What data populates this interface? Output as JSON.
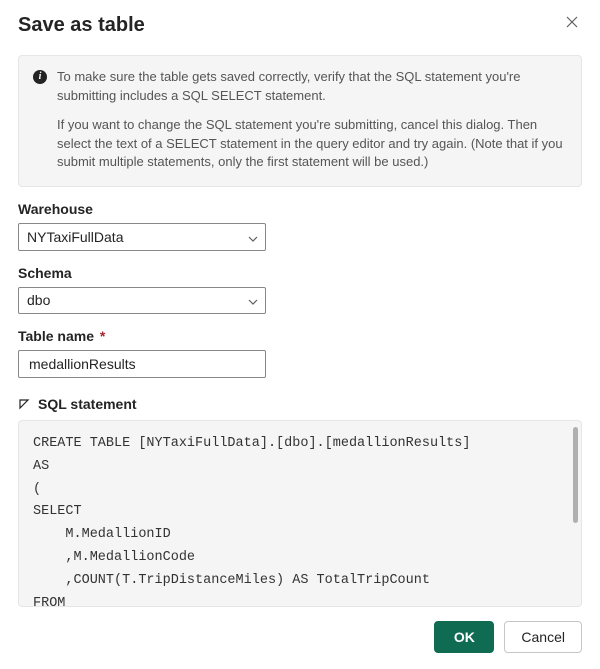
{
  "dialog": {
    "title": "Save as table",
    "info": {
      "p1": "To make sure the table gets saved correctly, verify that the SQL statement you're submitting includes a SQL SELECT statement.",
      "p2": "If you want to change the SQL statement you're submitting, cancel this dialog. Then select the text of a SELECT statement in the query editor and try again. (Note that if you submit multiple statements, only the first statement will be used.)"
    }
  },
  "fields": {
    "warehouse": {
      "label": "Warehouse",
      "value": "NYTaxiFullData"
    },
    "schema": {
      "label": "Schema",
      "value": "dbo"
    },
    "tableName": {
      "label": "Table name",
      "required": "*",
      "value": "medallionResults"
    }
  },
  "sql": {
    "header": "SQL statement",
    "code": "CREATE TABLE [NYTaxiFullData].[dbo].[medallionResults]\nAS\n(\nSELECT\n    M.MedallionID\n    ,M.MedallionCode\n    ,COUNT(T.TripDistanceMiles) AS TotalTripCount\nFROM\n    dbo.Trip AS T\nJOIN"
  },
  "buttons": {
    "ok": "OK",
    "cancel": "Cancel"
  }
}
